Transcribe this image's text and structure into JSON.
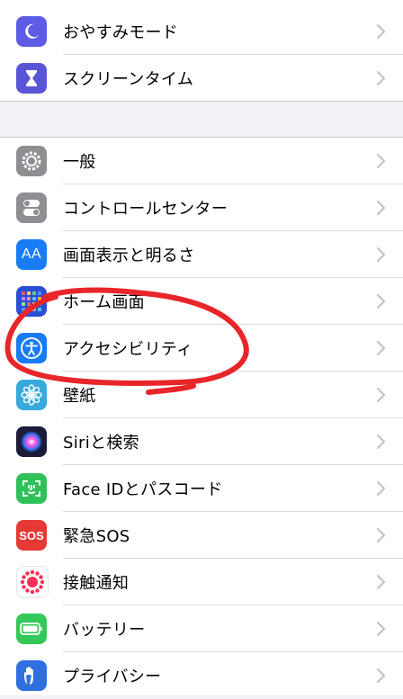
{
  "colors": {
    "group_bg": "#ffffff",
    "page_bg": "#f2f2f7",
    "annotation": "#e8262a",
    "chevron": "#c4c4c8"
  },
  "group1": [
    {
      "id": "do-not-disturb",
      "label": "おやすみモード",
      "icon": "moon-icon",
      "color": "#5e5ce6"
    },
    {
      "id": "screen-time",
      "label": "スクリーンタイム",
      "icon": "hourglass-icon",
      "color": "#5856d6"
    }
  ],
  "group2": [
    {
      "id": "general",
      "label": "一般",
      "icon": "gear-icon",
      "color": "#8e8e93"
    },
    {
      "id": "control-center",
      "label": "コントロールセンター",
      "icon": "toggles-icon",
      "color": "#8e8e93"
    },
    {
      "id": "display-brightness",
      "label": "画面表示と明るさ",
      "icon": "text-size-icon",
      "color": "#1a7cf5",
      "icon_text": "AA"
    },
    {
      "id": "home-screen",
      "label": "ホーム画面",
      "icon": "app-grid-icon",
      "color": "#2a4fd6"
    },
    {
      "id": "accessibility",
      "label": "アクセシビリティ",
      "icon": "accessibility-icon",
      "color": "#1a7cf5"
    },
    {
      "id": "wallpaper",
      "label": "壁紙",
      "icon": "flower-icon",
      "color": "#36aadc"
    },
    {
      "id": "siri-search",
      "label": "Siriと検索",
      "icon": "siri-icon",
      "color": "#1c1c3a"
    },
    {
      "id": "face-id",
      "label": "Face IDとパスコード",
      "icon": "face-id-icon",
      "color": "#30c05a"
    },
    {
      "id": "emergency-sos",
      "label": "緊急SOS",
      "icon": "sos-icon",
      "color": "#e53935",
      "icon_text": "SOS"
    },
    {
      "id": "exposure-notifications",
      "label": "接触通知",
      "icon": "exposure-icon",
      "color": "#ffffff"
    },
    {
      "id": "battery",
      "label": "バッテリー",
      "icon": "battery-icon",
      "color": "#34c759"
    },
    {
      "id": "privacy",
      "label": "プライバシー",
      "icon": "hand-icon",
      "color": "#2f6fe0"
    }
  ]
}
